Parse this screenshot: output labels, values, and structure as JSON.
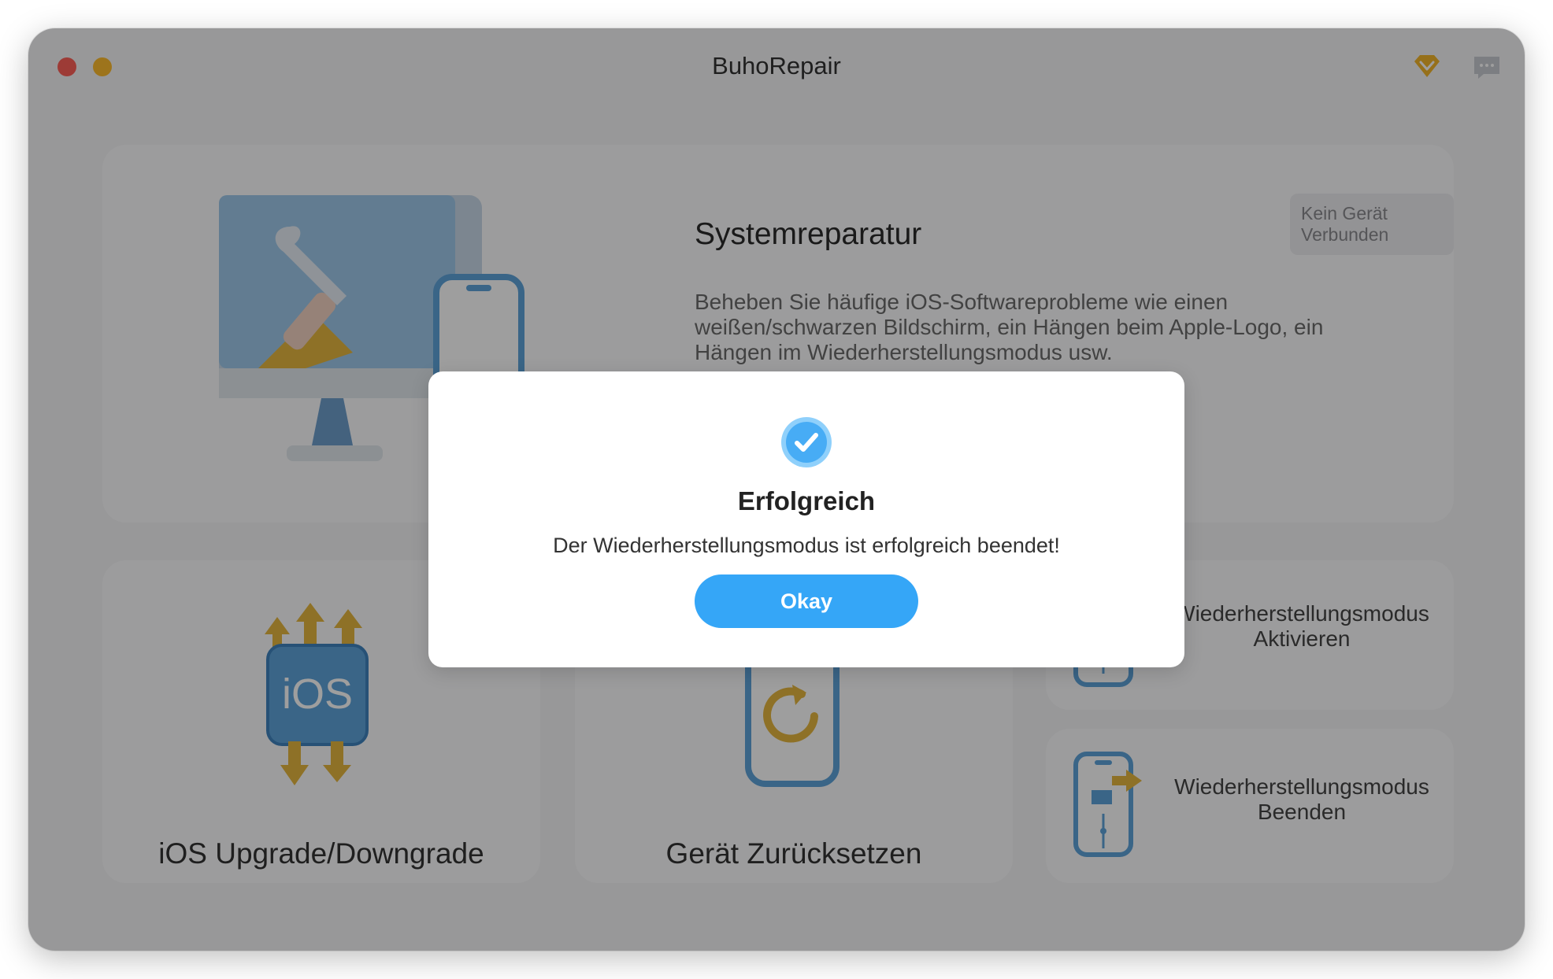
{
  "window": {
    "title": "BuhoRepair",
    "icons": [
      "premium-gem-icon",
      "feedback-chat-icon"
    ]
  },
  "system_repair": {
    "badge": "Kein Gerät Verbunden",
    "title": "Systemreparatur",
    "description": "Beheben Sie häufige iOS-Softwareprobleme wie einen weißen/schwarzen Bildschirm, ein Hängen beim Apple-Logo, ein Hängen im Wiederherstellungsmodus usw."
  },
  "tiles": {
    "ios": {
      "label": "iOS Upgrade/Downgrade",
      "icon_text": "iOS"
    },
    "reset": {
      "label": "Gerät Zurücksetzen"
    },
    "enter_recovery": {
      "line1": "Wiederherstellungsmodus",
      "line2": "Aktivieren"
    },
    "exit_recovery": {
      "line1": "Wiederherstellungsmodus",
      "line2": "Beenden"
    }
  },
  "dialog": {
    "title": "Erfolgreich",
    "message": "Der Wiederherstellungsmodus ist erfolgreich beendet!",
    "ok_label": "Okay"
  },
  "colors": {
    "accent": "#35a6f7",
    "close": "#fe5f57",
    "minimize": "#febc2e",
    "illustration_blue": "#5ea3da",
    "illustration_gold": "#e6b73f"
  }
}
